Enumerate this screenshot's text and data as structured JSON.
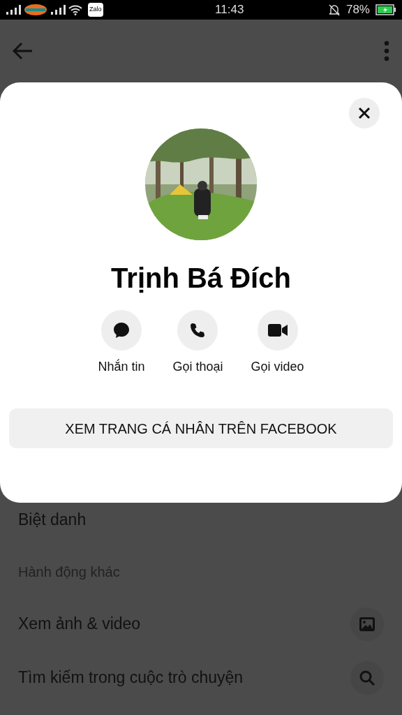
{
  "status_bar": {
    "time": "11:43",
    "battery": "78%",
    "app_badge": "Zalo"
  },
  "profile_card": {
    "name": "Trịnh Bá Đích",
    "actions": [
      {
        "kind": "message",
        "label": "Nhắn tin"
      },
      {
        "kind": "call",
        "label": "Gọi thoại"
      },
      {
        "kind": "video",
        "label": "Gọi video"
      }
    ],
    "profile_button": "XEM TRANG CÁ NHÂN TRÊN FACEBOOK"
  },
  "menu": [
    {
      "kind": "plain",
      "label": "Biệt danh"
    },
    {
      "kind": "section",
      "label": "Hành động khác"
    },
    {
      "kind": "media",
      "label": "Xem ảnh & video"
    },
    {
      "kind": "search",
      "label": "Tìm kiếm trong cuộc trò chuyện"
    }
  ]
}
